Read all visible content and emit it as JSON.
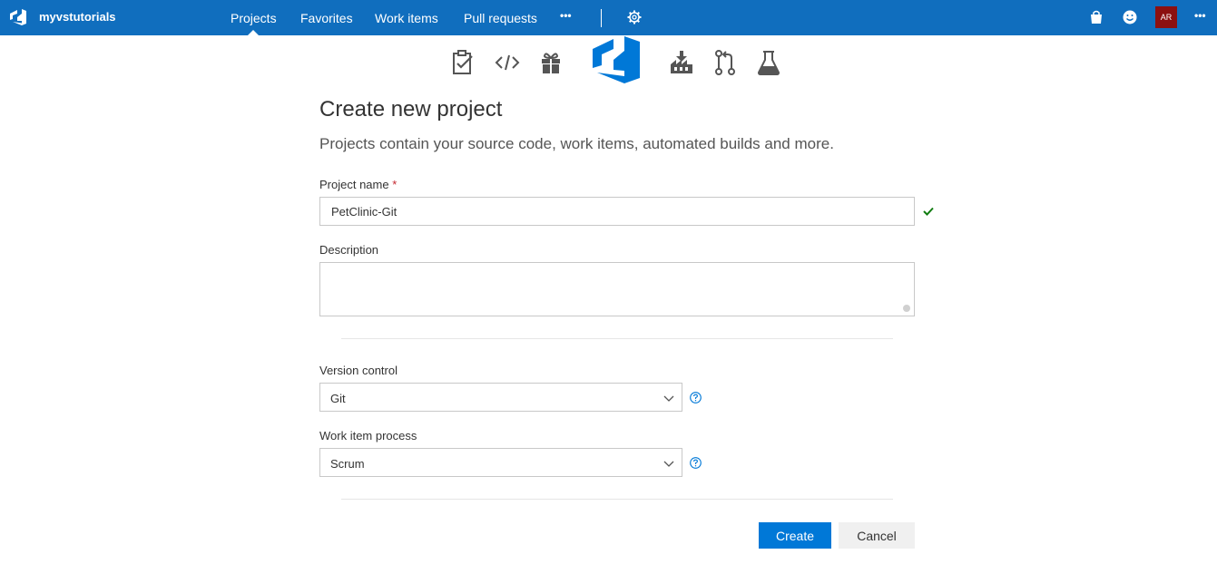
{
  "topbar": {
    "org_name": "myvstutorials",
    "nav": [
      "Projects",
      "Favorites",
      "Work items",
      "Pull requests"
    ],
    "active_nav": "Projects",
    "more_label": "•••",
    "avatar_initials": "AR"
  },
  "hub_icons": [
    "boards-icon",
    "code-icon",
    "gift-icon",
    "vsts-logo-icon",
    "build-icon",
    "pull-request-icon",
    "test-flask-icon"
  ],
  "form": {
    "title": "Create new project",
    "subtitle": "Projects contain your source code, work items, automated builds and more.",
    "project_name_label": "Project name",
    "required_mark": "*",
    "project_name_value": "PetClinic-Git",
    "description_label": "Description",
    "description_value": "",
    "version_control_label": "Version control",
    "version_control_value": "Git",
    "work_item_process_label": "Work item process",
    "work_item_process_value": "Scrum",
    "create_label": "Create",
    "cancel_label": "Cancel"
  },
  "colors": {
    "topbar": "#106ebe",
    "accent": "#0078d7",
    "avatar": "#8c1010",
    "valid": "#107c10"
  }
}
